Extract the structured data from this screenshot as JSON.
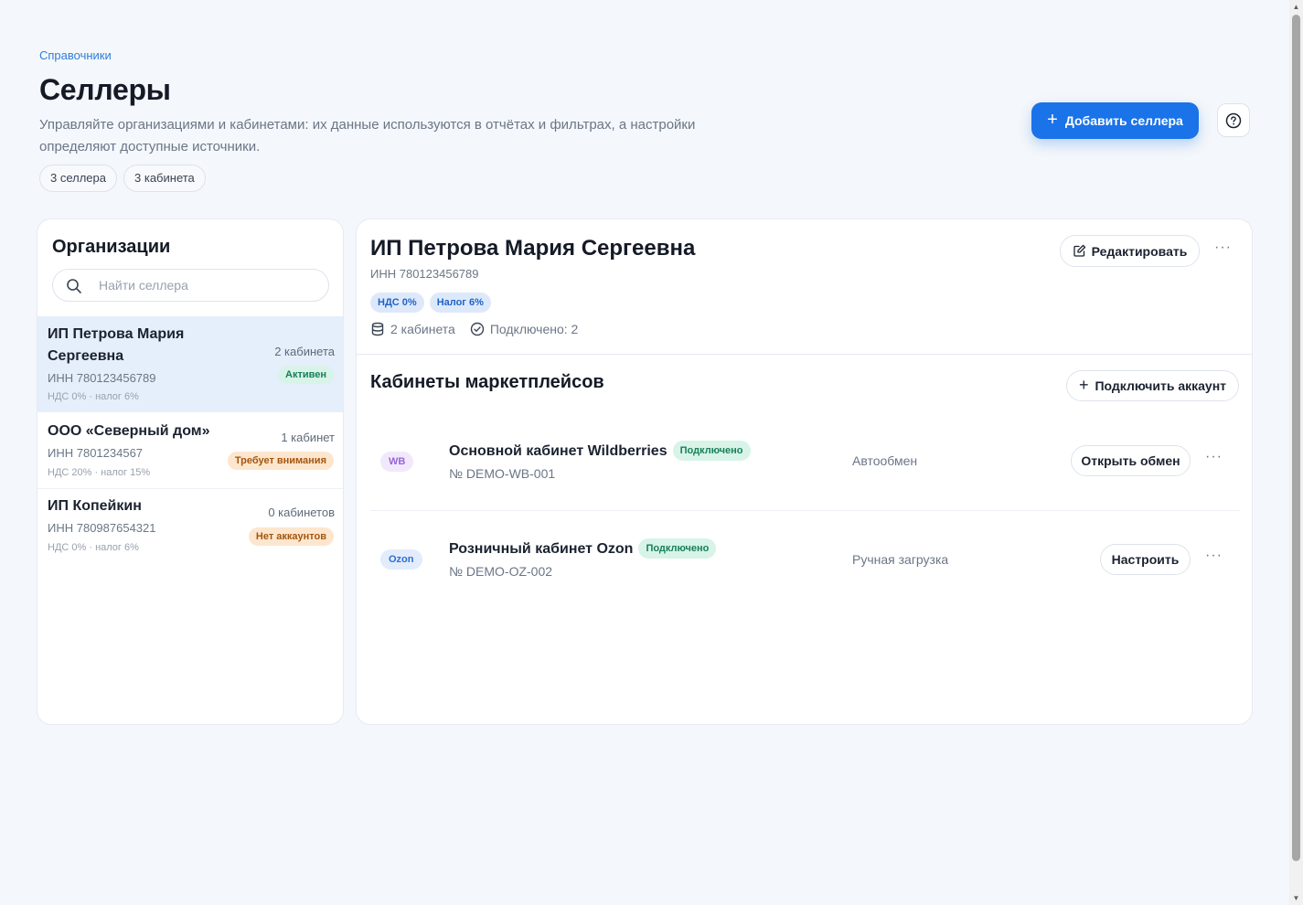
{
  "header": {
    "breadcrumb": "Справочники",
    "title": "Селлеры",
    "subtitle": "Управляйте организациями и кабинетами: их данные используются в отчётах и фильтрах, а настройки определяют доступные источники.",
    "chips": [
      "3 селлера",
      "3 кабинета"
    ],
    "add_button": "Добавить селлера"
  },
  "sidebar": {
    "title": "Организации",
    "search_placeholder": "Найти селлера",
    "sellers": [
      {
        "name": "ИП Петрова Мария Сергеевна",
        "inn": "ИНН 780123456789",
        "tax": "НДС 0% · налог 6%",
        "count": "2 кабинета",
        "status": "Активен"
      },
      {
        "name": "ООО «Северный дом»",
        "inn": "ИНН 7801234567",
        "tax": "НДС 20% · налог 15%",
        "count": "1 кабинет",
        "status": "Требует внимания"
      },
      {
        "name": "ИП Копейкин",
        "inn": "ИНН 780987654321",
        "tax": "НДС 0% · налог 6%",
        "count": "0 кабинетов",
        "status": "Нет аккаунтов"
      }
    ]
  },
  "detail": {
    "title": "ИП Петрова Мария Сергеевна",
    "inn": "ИНН 780123456789",
    "tags": [
      "НДС 0%",
      "Налог 6%"
    ],
    "cabinets_count": "2 кабинета",
    "connected": "Подключено: 2",
    "edit_button": "Редактировать",
    "cabinets_title": "Кабинеты маркетплейсов",
    "connect_button": "Подключить аккаунт",
    "accounts": [
      {
        "logo": "WB",
        "name": "Основной кабинет Wildberries",
        "status": "Подключено",
        "number": "№ DEMO-WB-001",
        "mode": "Автообмен",
        "action": "Открыть обмен"
      },
      {
        "logo": "Ozon",
        "name": "Розничный кабинет Ozon",
        "status": "Подключено",
        "number": "№ DEMO-OZ-002",
        "mode": "Ручная загрузка",
        "action": "Настроить"
      }
    ]
  },
  "colors": {
    "accent": "#1a73e8",
    "active_row": "#e5eefb",
    "status_green": "#17805a",
    "status_orange": "#a4560f"
  }
}
